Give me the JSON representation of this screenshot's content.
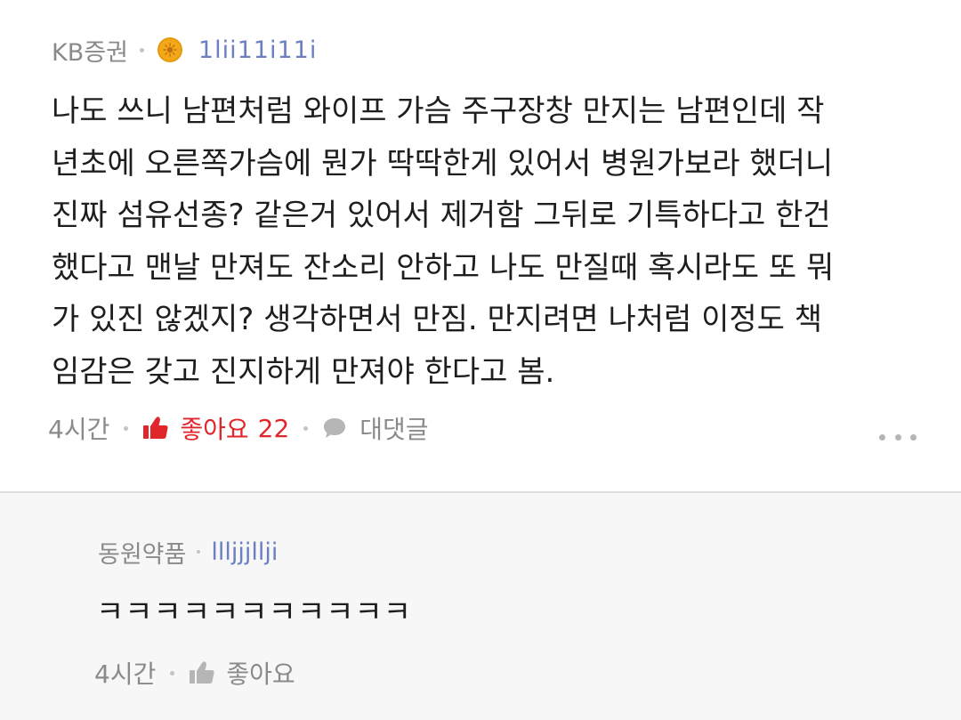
{
  "comment": {
    "author": "KB증권",
    "badge_icon": "sun-badge-icon",
    "username": "1lii11i11i",
    "body": "나도 쓰니 남편처럼 와이프 가슴 주구장창 만지는 남편인데 작\n년초에 오른쪽가슴에 뭔가 딱딱한게 있어서 병원가보라 했더니\n진짜 섬유선종? 같은거 있어서 제거함 그뒤로 기특하다고 한건\n했다고 맨날 만져도 잔소리 안하고 나도 만질때 혹시라도 또 뭐\n가 있진 않겠지? 생각하면서 만짐. 만지려면 나처럼 이정도 책\n임감은 갖고 진지하게 만져야 한다고 봄.",
    "time": "4시간",
    "like_label": "좋아요",
    "like_count": "22",
    "reply_label": "대댓글",
    "more_icon": "more-dots-icon"
  },
  "reply": {
    "author": "동원약품",
    "username": "llljjjllji",
    "body": "ㅋㅋㅋㅋㅋㅋㅋㅋㅋㅋㅋ",
    "time": "4시간",
    "like_label": "좋아요"
  },
  "colors": {
    "accent_like": "#e0262b",
    "username": "#6b7fc2",
    "meta_gray": "#8a8a8a",
    "reply_background": "#f7f7f7",
    "badge": "#f3a81a"
  }
}
